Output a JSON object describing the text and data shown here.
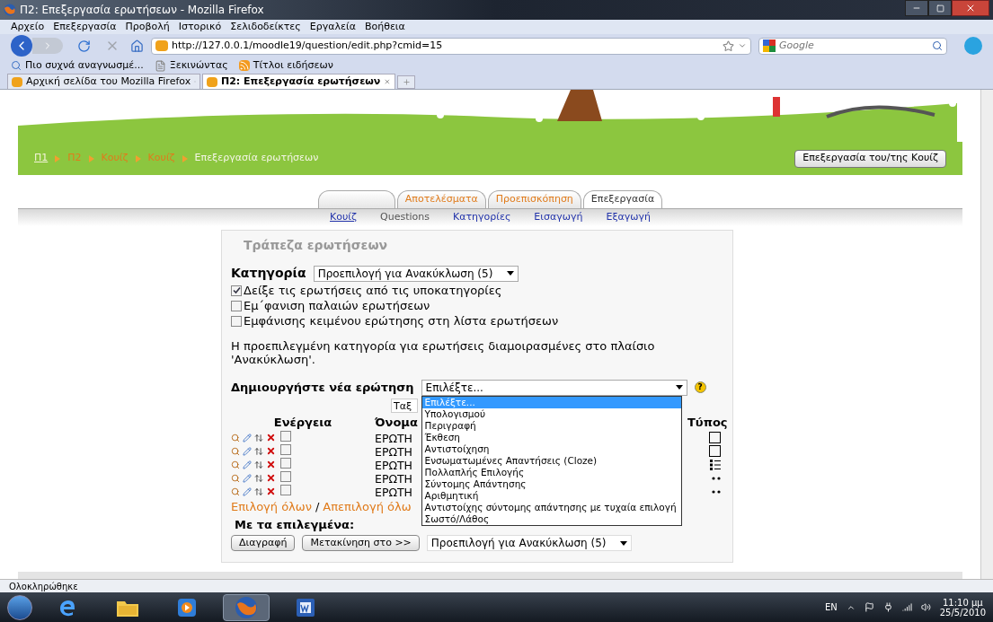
{
  "window": {
    "title": "Π2: Επεξεργασία ερωτήσεων - Mozilla Firefox"
  },
  "menu": [
    "Αρχείο",
    "Επεξεργασία",
    "Προβολή",
    "Ιστορικό",
    "Σελιδοδείκτες",
    "Εργαλεία",
    "Βοήθεια"
  ],
  "toolbar": {
    "url": "http://127.0.0.1/moodle19/question/edit.php?cmid=15",
    "search_placeholder": "Google"
  },
  "bookmarks": [
    {
      "label": "Πιο συχνά αναγνωσμέ...",
      "kind": "search"
    },
    {
      "label": "Ξεκινώντας",
      "kind": "page"
    },
    {
      "label": "Τίτλοι ειδήσεων",
      "kind": "feed"
    }
  ],
  "tabs": [
    {
      "label": "Αρχική σελίδα του Mozilla Firefox",
      "selected": false
    },
    {
      "label": "Π2: Επεξεργασία ερωτήσεων",
      "selected": true
    }
  ],
  "breadcrumb": [
    {
      "label": "Π1",
      "kind": "home"
    },
    {
      "label": "Π2",
      "kind": "link"
    },
    {
      "label": "Κουίζ",
      "kind": "link"
    },
    {
      "label": "Κουίζ",
      "kind": "link"
    },
    {
      "label": "Επεξεργασία ερωτήσεων",
      "kind": "current"
    }
  ],
  "header_button": "Επεξεργασία του/της Κουίζ",
  "module_tabs": [
    {
      "selected": false
    },
    {
      "label": "Αποτελέσματα",
      "selected": false
    },
    {
      "label": "Προεπισκόπηση",
      "selected": false
    },
    {
      "label": "Επεξεργασία",
      "selected": true
    }
  ],
  "subtabs": [
    {
      "label": "Κουίζ",
      "selected": false
    },
    {
      "label": "Questions",
      "selected": true
    },
    {
      "label": "Κατηγορίες",
      "selected": false
    },
    {
      "label": "Εισαγωγή",
      "selected": false
    },
    {
      "label": "Εξαγωγή",
      "selected": false
    }
  ],
  "panel": {
    "title": "Τράπεζα ερωτήσεων",
    "category": {
      "label": "Κατηγορία",
      "value": "Προεπιλογή για Ανακύκλωση (5)"
    },
    "options": [
      {
        "label": "Δείξε τις ερωτήσεις από τις υποκατηγορίες",
        "checked": true
      },
      {
        "label": "Εμ΄φανιση παλαιών ερωτήσεων",
        "checked": false
      },
      {
        "label": "Εμφάνισης κειμένου ερώτησης στη λίστα ερωτήσεων",
        "checked": false
      }
    ],
    "note": "Η προεπιλεγμένη κατηγορία για ερωτήσεις διαμοιρασμένες στο πλαίσιο 'Ανακύκλωση'.",
    "create": {
      "label": "Δημιουργήστε νέα ερώτηση",
      "value": "Επιλέξτε...",
      "expanded": true,
      "options": [
        {
          "label": "Επιλέξτε...",
          "selected": true
        },
        {
          "label": "Υπολογισμού",
          "selected": false
        },
        {
          "label": "Περιγραφή",
          "selected": false
        },
        {
          "label": "Έκθεση",
          "selected": false
        },
        {
          "label": "Αντιστοίχηση",
          "selected": false
        },
        {
          "label": "Ενσωματωμένες Απαντήσεις (Cloze)",
          "selected": false
        },
        {
          "label": "Πολλαπλής Επιλογής",
          "selected": false
        },
        {
          "label": "Σύντομης Απάντησης",
          "selected": false
        },
        {
          "label": "Αριθμητική",
          "selected": false
        },
        {
          "label": "Αντιστοίχης σύντομης απάντησης με τυχαία επιλογή",
          "selected": false
        },
        {
          "label": "Σωστό/Λάθος",
          "selected": false
        }
      ]
    },
    "help_mark": "?",
    "sort_value": "Ταξ",
    "columns": [
      "Ενέργεια",
      "Όνομα",
      "Τύπος"
    ],
    "rows": [
      {
        "name": "ΕΡΩΤΗ",
        "checked": false,
        "kind": "box"
      },
      {
        "name": "ΕΡΩΤΗ",
        "checked": false,
        "kind": "box"
      },
      {
        "name": "ΕΡΩΤΗ",
        "checked": false,
        "kind": "list"
      },
      {
        "name": "ΕΡΩΤΗ",
        "checked": false,
        "kind": "dots"
      },
      {
        "name": "ΕΡΩΤΗ",
        "checked": false,
        "kind": "dots"
      }
    ],
    "select_all": "Επιλογή όλων",
    "separator": "/",
    "deselect_all": "Απεπιλογή όλω",
    "with_selected": "Με τα επιλεγμένα:",
    "buttons": [
      "Διαγραφή",
      "Μετακίνηση στο >>"
    ],
    "move_target": "Προεπιλογή για Ανακύκλωση (5)"
  },
  "status": "Ολοκληρώθηκε",
  "taskbar": {
    "apps": [
      {
        "kind": "browser-e",
        "selected": false
      },
      {
        "kind": "folder",
        "selected": false
      },
      {
        "kind": "media",
        "selected": false
      },
      {
        "kind": "firefox",
        "selected": true
      },
      {
        "kind": "word",
        "selected": false
      }
    ],
    "language": "EN",
    "time": "11:10 μμ",
    "date": "25/5/2010"
  }
}
